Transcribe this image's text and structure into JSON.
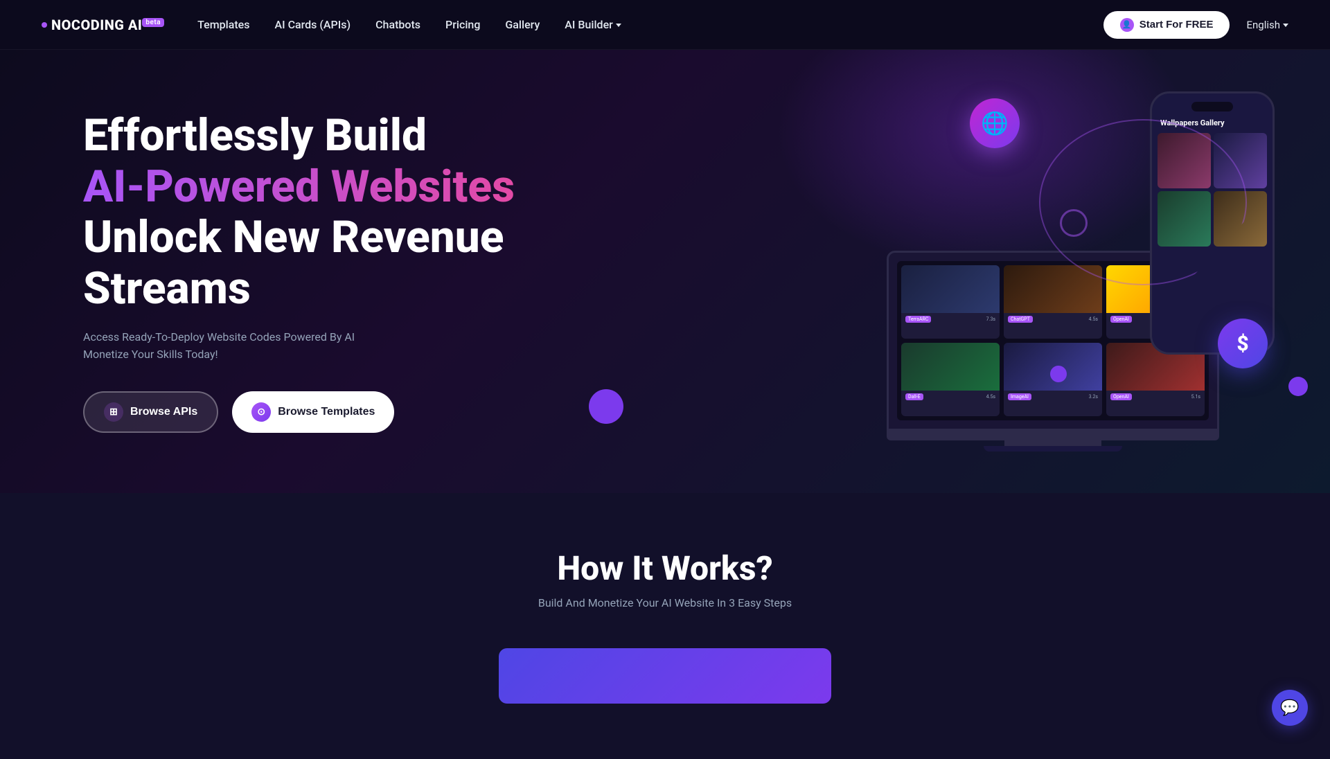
{
  "nav": {
    "logo_text": "NOCODING AI",
    "logo_beta": "beta",
    "links": [
      {
        "label": "Templates",
        "id": "templates"
      },
      {
        "label": "AI Cards (APIs)",
        "id": "ai-cards"
      },
      {
        "label": "Chatbots",
        "id": "chatbots"
      },
      {
        "label": "Pricing",
        "id": "pricing"
      },
      {
        "label": "Gallery",
        "id": "gallery"
      },
      {
        "label": "AI Builder",
        "id": "ai-builder",
        "has_dropdown": true
      }
    ],
    "cta_label": "Start For FREE",
    "lang": "English"
  },
  "hero": {
    "title_line1": "Effortlessly Build",
    "title_gradient": "AI-Powered Websites",
    "title_line3": "Unlock New Revenue Streams",
    "description_line1": "Access Ready-To-Deploy Website Codes Powered By AI",
    "description_line2": "Monetize Your Skills Today!",
    "btn_apis": "Browse APIs",
    "btn_templates": "Browse Templates"
  },
  "how_it_works": {
    "title": "How It Works?",
    "subtitle": "Build And Monetize Your AI Website In 3 Easy Steps"
  },
  "phone_gallery": {
    "title": "Wallpapers Gallery"
  },
  "chat_icon": "💬"
}
